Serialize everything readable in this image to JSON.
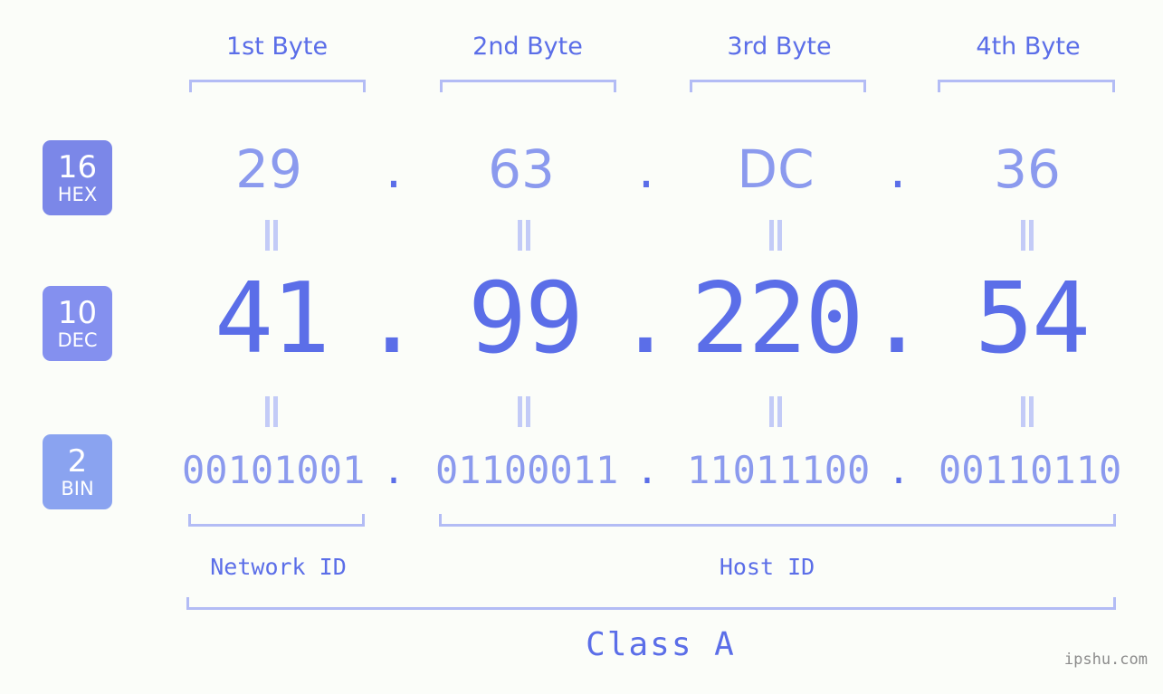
{
  "page": {
    "background_color": "#fbfdf9",
    "accent_color": "#5b6ee8",
    "accent_light_color": "#8b9aee",
    "bracket_color": "#b3bcf5",
    "badge_color_hex": "#7b87e8",
    "badge_color_dec": "#8490ef",
    "badge_color_bin": "#8aa3f0"
  },
  "byte_headers": [
    {
      "label": "1st Byte"
    },
    {
      "label": "2nd Byte"
    },
    {
      "label": "3rd Byte"
    },
    {
      "label": "4th Byte"
    }
  ],
  "rows": [
    {
      "radix_number": "16",
      "radix_name": "HEX",
      "octets": [
        "29",
        "63",
        "DC",
        "36"
      ],
      "separator": "."
    },
    {
      "radix_number": "10",
      "radix_name": "DEC",
      "octets": [
        "41",
        "99",
        "220",
        "54"
      ],
      "separator": "."
    },
    {
      "radix_number": "2",
      "radix_name": "BIN",
      "octets": [
        "00101001",
        "01100011",
        "11011100",
        "00110110"
      ],
      "separator": "."
    }
  ],
  "equals_sign": "=",
  "id_sections": [
    {
      "label": "Network ID"
    },
    {
      "label": "Host ID"
    }
  ],
  "class_label": "Class A",
  "watermark": "ipshu.com"
}
